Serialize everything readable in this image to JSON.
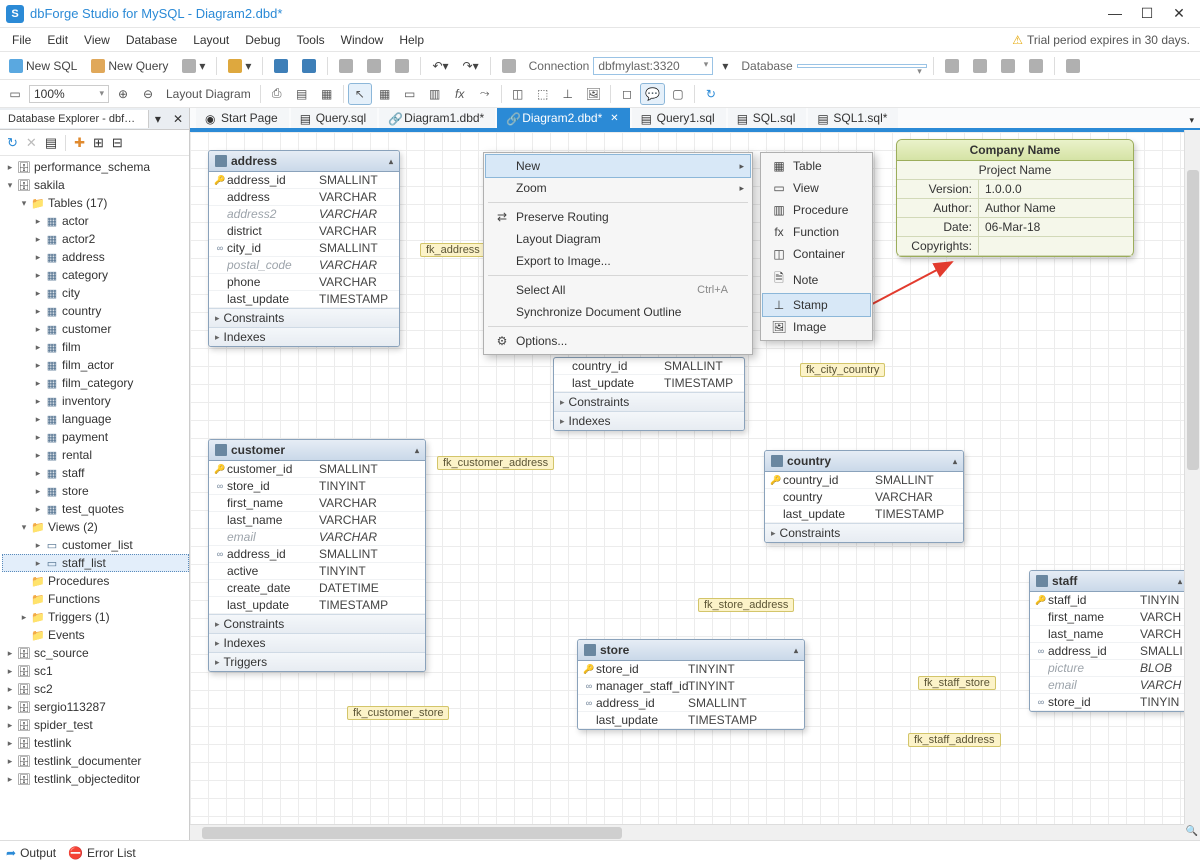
{
  "title": "dbForge Studio for MySQL - Diagram2.dbd*",
  "menu": [
    "File",
    "Edit",
    "View",
    "Database",
    "Layout",
    "Debug",
    "Tools",
    "Window",
    "Help"
  ],
  "trial": "Trial period expires in 30 days.",
  "toolbar1": {
    "newSql": "New SQL",
    "newQuery": "New Query",
    "connLbl": "Connection",
    "connVal": "dbfmylast:3320",
    "dbLbl": "Database"
  },
  "toolbar2": {
    "zoom": "100%",
    "layoutBtn": "Layout Diagram"
  },
  "sidebar": {
    "tabTitle": "Database Explorer - dbfmyl…",
    "tree": {
      "perf": "performance_schema",
      "sakila": "sakila",
      "tables": "Tables (17)",
      "tlist": [
        "actor",
        "actor2",
        "address",
        "category",
        "city",
        "country",
        "customer",
        "film",
        "film_actor",
        "film_category",
        "inventory",
        "language",
        "payment",
        "rental",
        "staff",
        "store",
        "test_quotes"
      ],
      "views": "Views (2)",
      "vlist": [
        "customer_list",
        "staff_list"
      ],
      "procs": "Procedures",
      "funcs": "Functions",
      "trigs": "Triggers (1)",
      "events": "Events",
      "rest": [
        "sc_source",
        "sc1",
        "sc2",
        "sergio113287",
        "spider_test",
        "testlink",
        "testlink_documenter",
        "testlink_objecteditor"
      ]
    }
  },
  "docTabs": [
    {
      "label": "Start Page",
      "active": false
    },
    {
      "label": "Query.sql",
      "active": false
    },
    {
      "label": "Diagram1.dbd*",
      "active": false
    },
    {
      "label": "Diagram2.dbd*",
      "active": true
    },
    {
      "label": "Query1.sql",
      "active": false
    },
    {
      "label": "SQL.sql",
      "active": false
    },
    {
      "label": "SQL1.sql*",
      "active": false
    }
  ],
  "entities": {
    "address": {
      "name": "address",
      "cols": [
        {
          "k": "🔑",
          "n": "address_id",
          "t": "SMALLINT"
        },
        {
          "k": "",
          "n": "address",
          "t": "VARCHAR"
        },
        {
          "k": "",
          "n": "address2",
          "t": "VARCHAR",
          "it": true
        },
        {
          "k": "",
          "n": "district",
          "t": "VARCHAR"
        },
        {
          "k": "∞",
          "n": "city_id",
          "t": "SMALLINT"
        },
        {
          "k": "",
          "n": "postal_code",
          "t": "VARCHAR",
          "it": true
        },
        {
          "k": "",
          "n": "phone",
          "t": "VARCHAR"
        },
        {
          "k": "",
          "n": "last_update",
          "t": "TIMESTAMP"
        }
      ],
      "sects": [
        "Constraints",
        "Indexes"
      ]
    },
    "customer": {
      "name": "customer",
      "cols": [
        {
          "k": "🔑",
          "n": "customer_id",
          "t": "SMALLINT"
        },
        {
          "k": "∞",
          "n": "store_id",
          "t": "TINYINT"
        },
        {
          "k": "",
          "n": "first_name",
          "t": "VARCHAR"
        },
        {
          "k": "",
          "n": "last_name",
          "t": "VARCHAR"
        },
        {
          "k": "",
          "n": "email",
          "t": "VARCHAR",
          "it": true
        },
        {
          "k": "∞",
          "n": "address_id",
          "t": "SMALLINT"
        },
        {
          "k": "",
          "n": "active",
          "t": "TINYINT"
        },
        {
          "k": "",
          "n": "create_date",
          "t": "DATETIME"
        },
        {
          "k": "",
          "n": "last_update",
          "t": "TIMESTAMP"
        }
      ],
      "sects": [
        "Constraints",
        "Indexes",
        "Triggers"
      ]
    },
    "country": {
      "name": "country",
      "cols": [
        {
          "k": "🔑",
          "n": "country_id",
          "t": "SMALLINT"
        },
        {
          "k": "",
          "n": "country",
          "t": "VARCHAR"
        },
        {
          "k": "",
          "n": "last_update",
          "t": "TIMESTAMP"
        }
      ],
      "sects": [
        "Constraints"
      ]
    },
    "cityPartial": {
      "cols": [
        {
          "k": "",
          "n": "country_id",
          "t": "SMALLINT"
        },
        {
          "k": "",
          "n": "last_update",
          "t": "TIMESTAMP"
        }
      ],
      "sects": [
        "Constraints",
        "Indexes"
      ]
    },
    "store": {
      "name": "store",
      "cols": [
        {
          "k": "🔑",
          "n": "store_id",
          "t": "TINYINT"
        },
        {
          "k": "∞",
          "n": "manager_staff_id",
          "t": "TINYINT"
        },
        {
          "k": "∞",
          "n": "address_id",
          "t": "SMALLINT"
        },
        {
          "k": "",
          "n": "last_update",
          "t": "TIMESTAMP"
        }
      ]
    },
    "staff": {
      "name": "staff",
      "cols": [
        {
          "k": "🔑",
          "n": "staff_id",
          "t": "TINYIN"
        },
        {
          "k": "",
          "n": "first_name",
          "t": "VARCH"
        },
        {
          "k": "",
          "n": "last_name",
          "t": "VARCH"
        },
        {
          "k": "∞",
          "n": "address_id",
          "t": "SMALLI"
        },
        {
          "k": "",
          "n": "picture",
          "t": "BLOB",
          "it": true
        },
        {
          "k": "",
          "n": "email",
          "t": "VARCH",
          "it": true
        },
        {
          "k": "∞",
          "n": "store_id",
          "t": "TINYIN"
        }
      ]
    }
  },
  "fk": {
    "addr": "fk_address",
    "custAddr": "fk_customer_address",
    "custStore": "fk_customer_store",
    "cityCountry": "fk_city_country",
    "storeAddr": "fk_store_address",
    "staffStore": "fk_staff_store",
    "staffAddr": "fk_staff_address"
  },
  "stamp": {
    "company": "Company Name",
    "project": "Project Name",
    "verL": "Version:",
    "ver": "1.0.0.0",
    "authL": "Author:",
    "auth": "Author Name",
    "dateL": "Date:",
    "date": "06-Mar-18",
    "copyL": "Copyrights:",
    "copy": ""
  },
  "ctx1": [
    {
      "lbl": "New",
      "sub": true,
      "hi": true
    },
    {
      "lbl": "Zoom",
      "sub": true
    },
    {
      "sep": true
    },
    {
      "icn": "⇄",
      "lbl": "Preserve Routing"
    },
    {
      "lbl": "Layout Diagram"
    },
    {
      "lbl": "Export to Image..."
    },
    {
      "sep": true
    },
    {
      "lbl": "Select All",
      "key": "Ctrl+A"
    },
    {
      "lbl": "Synchronize Document Outline"
    },
    {
      "sep": true
    },
    {
      "icn": "⚙",
      "lbl": "Options..."
    }
  ],
  "ctx2": [
    {
      "icn": "▦",
      "lbl": "Table"
    },
    {
      "icn": "▭",
      "lbl": "View"
    },
    {
      "icn": "▥",
      "lbl": "Procedure"
    },
    {
      "icn": "fx",
      "lbl": "Function"
    },
    {
      "icn": "◫",
      "lbl": "Container"
    },
    {
      "icn": "🗎",
      "lbl": "Note"
    },
    {
      "icn": "⊥",
      "lbl": "Stamp",
      "hi": true
    },
    {
      "icn": "🖼",
      "lbl": "Image"
    }
  ],
  "status": {
    "output": "Output",
    "errors": "Error List"
  }
}
